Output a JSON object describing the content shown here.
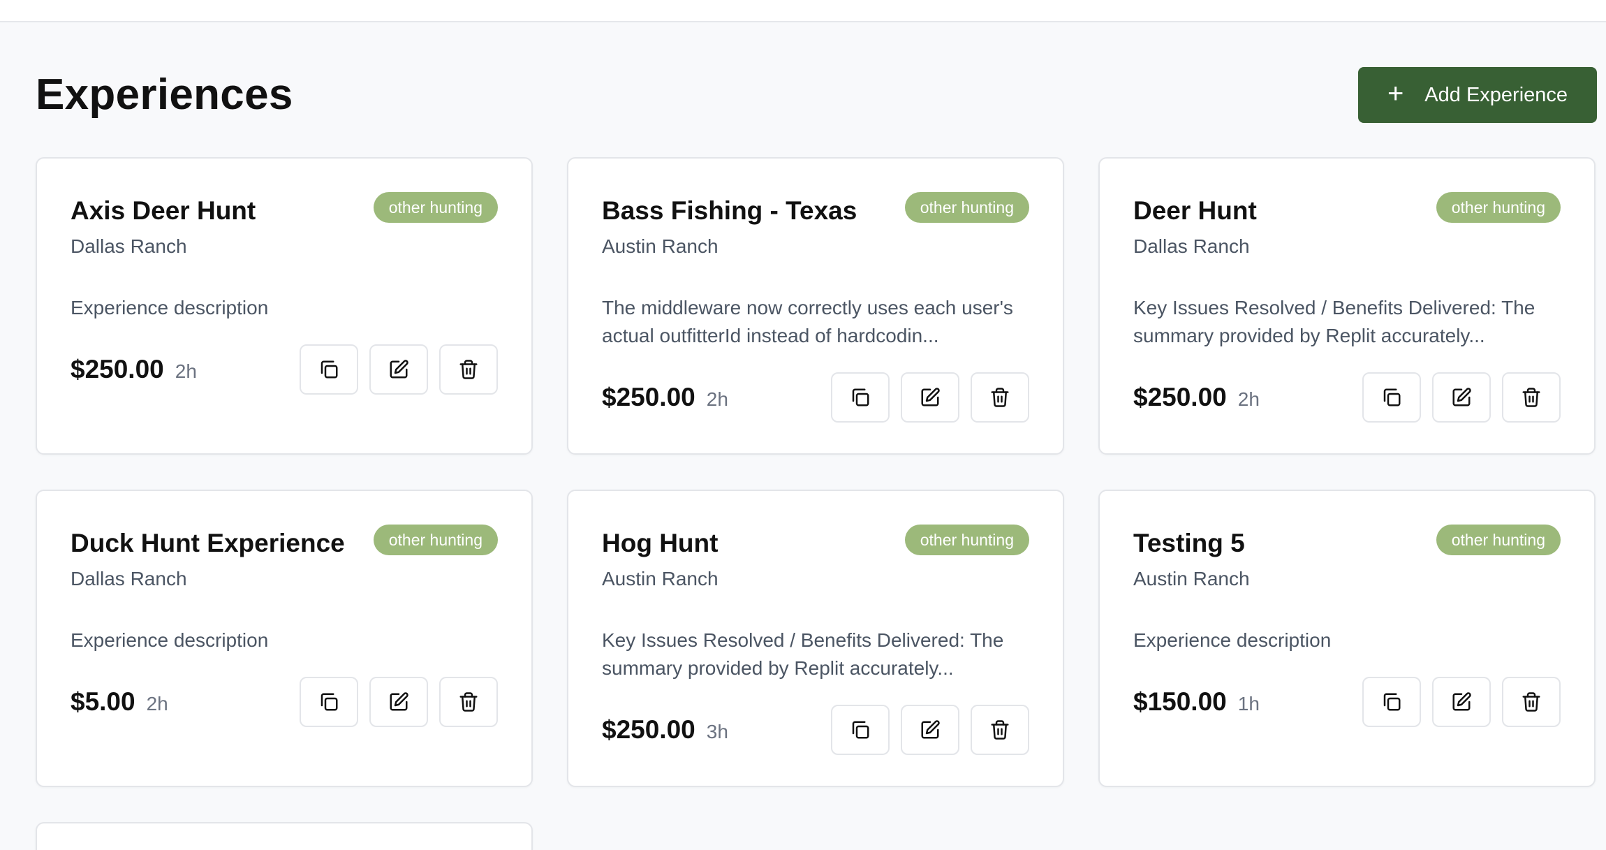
{
  "page": {
    "title": "Experiences",
    "add_button_label": "Add Experience",
    "add_button_icon": "plus-icon",
    "accent_color": "#386034",
    "badge_color": "#9cb97a"
  },
  "experiences": [
    {
      "title": "Axis Deer Hunt",
      "category": "other hunting",
      "location": "Dallas Ranch",
      "description": "Experience description",
      "price": "$250.00",
      "duration": "2h"
    },
    {
      "title": "Bass Fishing - Texas",
      "category": "other hunting",
      "location": "Austin Ranch",
      "description": "The middleware now correctly uses each user's actual outfitterId instead of hardcodin...",
      "price": "$250.00",
      "duration": "2h"
    },
    {
      "title": "Deer Hunt",
      "category": "other hunting",
      "location": "Dallas Ranch",
      "description": "Key Issues Resolved / Benefits Delivered: The summary provided by Replit accurately...",
      "price": "$250.00",
      "duration": "2h"
    },
    {
      "title": "Duck Hunt Experience",
      "category": "other hunting",
      "location": "Dallas Ranch",
      "description": "Experience description",
      "price": "$5.00",
      "duration": "2h"
    },
    {
      "title": "Hog Hunt",
      "category": "other hunting",
      "location": "Austin Ranch",
      "description": "Key Issues Resolved / Benefits Delivered: The summary provided by Replit accurately...",
      "price": "$250.00",
      "duration": "3h"
    },
    {
      "title": "Testing 5",
      "category": "other hunting",
      "location": "Austin Ranch",
      "description": "Experience description",
      "price": "$150.00",
      "duration": "1h"
    }
  ],
  "card_actions": [
    "copy-icon",
    "edit-icon",
    "trash-icon"
  ]
}
